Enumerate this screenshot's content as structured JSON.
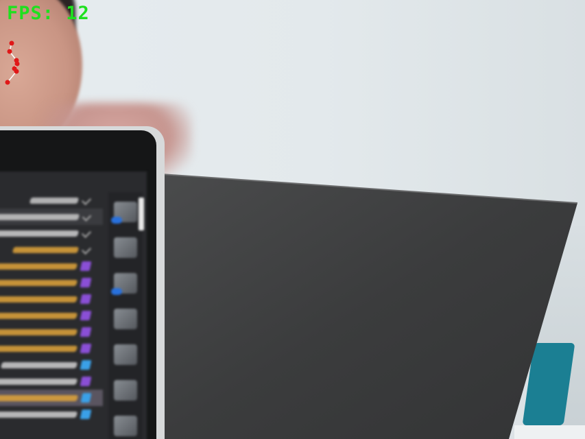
{
  "overlay": {
    "fps_label": "FPS: 12",
    "fps_color": "#1fe01f",
    "landmark_color": "#e01818"
  },
  "scene": {
    "board_color": "#3a3b3c",
    "chair_color": "#1b7f93",
    "wall_color": "#e3e9ec"
  },
  "ide_rows": [
    {
      "text": "",
      "swatch": "",
      "color": "#c9c9c9",
      "kind": "plain"
    },
    {
      "text": "",
      "swatch": "",
      "color": "#c9c9c9",
      "kind": "sel"
    },
    {
      "text": "",
      "swatch": "",
      "color": "#d0d0d0",
      "kind": "plain"
    },
    {
      "text": "",
      "swatch": "",
      "color": "#e0a53a",
      "kind": "plain"
    },
    {
      "text": "",
      "swatch": "#8a4fd6",
      "color": "#e0a53a",
      "kind": "plain"
    },
    {
      "text": "",
      "swatch": "#8a4fd6",
      "color": "#e0a53a",
      "kind": "plain"
    },
    {
      "text": "",
      "swatch": "#8a4fd6",
      "color": "#e0a53a",
      "kind": "plain"
    },
    {
      "text": "",
      "swatch": "#8a4fd6",
      "color": "#e0a53a",
      "kind": "plain"
    },
    {
      "text": "",
      "swatch": "#8a4fd6",
      "color": "#e0a53a",
      "kind": "plain"
    },
    {
      "text": "",
      "swatch": "#8a4fd6",
      "color": "#e0a53a",
      "kind": "plain"
    },
    {
      "text": "",
      "swatch": "#3aa0e8",
      "color": "#d0d0d0",
      "kind": "plain"
    },
    {
      "text": "",
      "swatch": "#8a4fd6",
      "color": "#d0d0d0",
      "kind": "plain"
    },
    {
      "text": "",
      "swatch": "#3aa0e8",
      "color": "#e0a53a",
      "kind": "hl"
    },
    {
      "text": "",
      "swatch": "#3aa0e8",
      "color": "#d0d0d0",
      "kind": "plain"
    }
  ],
  "toolbar_icons": [
    {
      "name": "shape-tool-icon",
      "blue": true
    },
    {
      "name": "search-icon",
      "blue": false
    },
    {
      "name": "layers-tool-icon",
      "blue": true
    },
    {
      "name": "plane-tool-icon",
      "blue": false
    },
    {
      "name": "boolean-tool-icon",
      "blue": false
    },
    {
      "name": "extrude-tool-icon",
      "blue": false
    },
    {
      "name": "flask-icon",
      "blue": false
    }
  ]
}
